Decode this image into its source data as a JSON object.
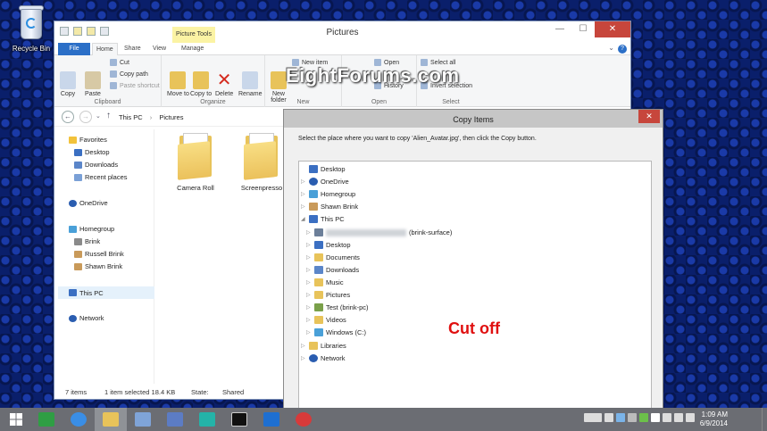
{
  "desktop": {
    "recycle_bin_label": "Recycle Bin"
  },
  "explorer": {
    "title": "Pictures",
    "context_tab": "Picture Tools",
    "tabs": {
      "file": "File",
      "home": "Home",
      "share": "Share",
      "view": "View",
      "manage": "Manage"
    },
    "ribbon": {
      "copy": "Copy",
      "paste": "Paste",
      "cut": "Cut",
      "copy_path": "Copy path",
      "paste_shortcut": "Paste shortcut",
      "clipboard": "Clipboard",
      "move_to": "Move to",
      "copy_to": "Copy to",
      "delete": "Delete",
      "rename": "Rename",
      "organize": "Organize",
      "new_folder": "New folder",
      "new_item": "New item",
      "new": "New",
      "open": "Open",
      "history": "History",
      "open_group": "Open",
      "select_all": "Select all",
      "invert_selection": "Invert selection",
      "select": "Select"
    },
    "breadcrumb": [
      "This PC",
      "Pictures"
    ],
    "nav": {
      "favorites": "Favorites",
      "desktop": "Desktop",
      "downloads": "Downloads",
      "recent_places": "Recent places",
      "onedrive": "OneDrive",
      "homegroup": "Homegroup",
      "brink": "Brink",
      "russell_brink": "Russell Brink",
      "shawn_brink": "Shawn Brink",
      "this_pc": "This PC",
      "network": "Network"
    },
    "folders": [
      "Camera Roll",
      "Screenpresso"
    ],
    "status": {
      "items": "7 items",
      "selected": "1 item selected  18.4 KB",
      "state": "State:",
      "shared": "Shared"
    }
  },
  "watermark": "EightForums.com",
  "dialog": {
    "title": "Copy Items",
    "close_label": "✕",
    "message": "Select the place where you want to copy 'Alien_Avatar.jpg', then click the Copy button.",
    "tree": {
      "desktop": "Desktop",
      "onedrive": "OneDrive",
      "homegroup": "Homegroup",
      "shawn_brink": "Shawn Brink",
      "this_pc": "This PC",
      "device_suffix": "(brink-surface)",
      "desktop2": "Desktop",
      "documents": "Documents",
      "downloads": "Downloads",
      "music": "Music",
      "pictures": "Pictures",
      "test": "Test (brink-pc)",
      "videos": "Videos",
      "windows_c": "Windows (C:)",
      "libraries": "Libraries",
      "network": "Network"
    },
    "annotation": "Cut off"
  },
  "taskbar": {
    "time": "1:09 AM",
    "date": "6/9/2014"
  },
  "icons": {
    "recycle_bin": "recycle-bin-icon",
    "start": "windows-start-icon",
    "store": "store-icon",
    "ie": "internet-explorer-icon",
    "explorer": "file-explorer-icon",
    "mail": "mail-icon"
  },
  "colors": {
    "file_tab": "#2b6fc7",
    "close_button": "#c7463c",
    "context_tab": "#fbf3a4",
    "annotation": "#e01010",
    "taskbar": "#6b6d73"
  }
}
